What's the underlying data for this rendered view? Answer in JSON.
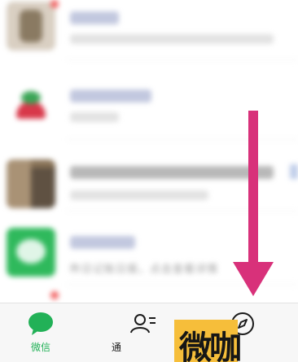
{
  "chat_list": {
    "items": [
      {
        "has_badge": true
      },
      {
        "has_badge": false
      },
      {
        "has_badge": false
      },
      {
        "preview": "昨日记账日报，点击查看详情",
        "has_badge": false
      }
    ]
  },
  "tabbar": {
    "tabs": [
      {
        "label": "微信",
        "active": true,
        "icon": "chat-bubble-icon"
      },
      {
        "label": "通",
        "active": false,
        "icon": "contacts-icon"
      },
      {
        "label": "",
        "active": false,
        "icon": "discover-compass-icon"
      }
    ]
  },
  "annotation": {
    "arrow_color": "#d8317a"
  },
  "watermark": {
    "text": "微咖",
    "bg_color": "#f6be3a"
  },
  "colors": {
    "accent_green": "#22b157",
    "badge_red": "#f26060"
  }
}
